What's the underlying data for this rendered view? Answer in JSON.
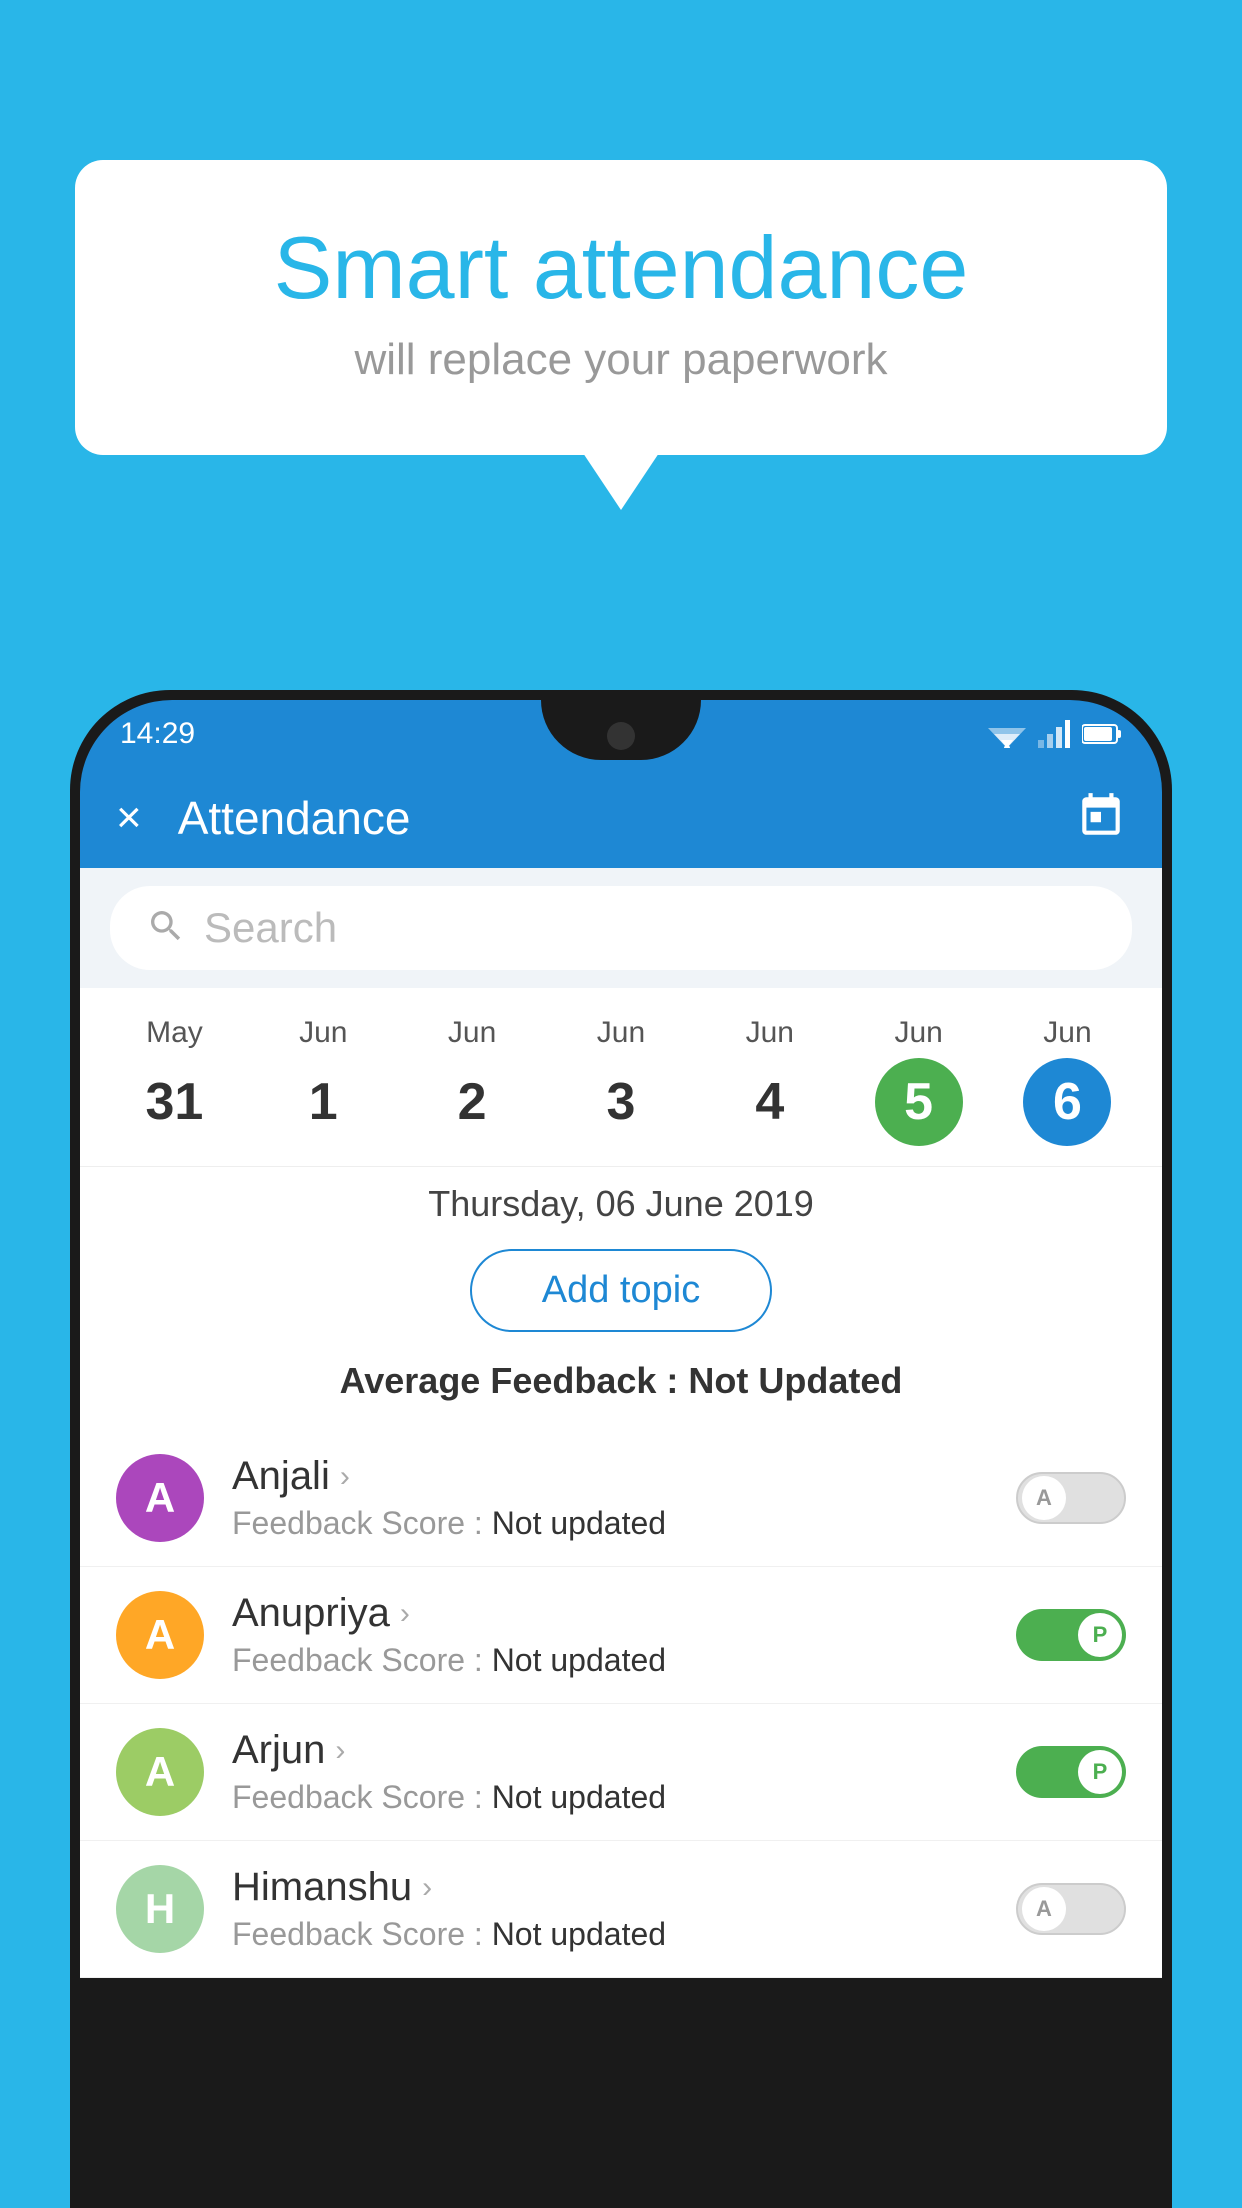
{
  "background_color": "#29b6e8",
  "bubble": {
    "title": "Smart attendance",
    "subtitle": "will replace your paperwork"
  },
  "status_bar": {
    "time": "14:29"
  },
  "app_bar": {
    "title": "Attendance",
    "close_label": "×"
  },
  "search": {
    "placeholder": "Search"
  },
  "calendar": {
    "days": [
      {
        "month": "May",
        "date": "31",
        "state": "normal"
      },
      {
        "month": "Jun",
        "date": "1",
        "state": "normal"
      },
      {
        "month": "Jun",
        "date": "2",
        "state": "normal"
      },
      {
        "month": "Jun",
        "date": "3",
        "state": "normal"
      },
      {
        "month": "Jun",
        "date": "4",
        "state": "normal"
      },
      {
        "month": "Jun",
        "date": "5",
        "state": "today"
      },
      {
        "month": "Jun",
        "date": "6",
        "state": "selected"
      }
    ],
    "selected_label": "Thursday, 06 June 2019"
  },
  "add_topic": {
    "label": "Add topic"
  },
  "avg_feedback": {
    "label": "Average Feedback :",
    "value": "Not Updated"
  },
  "students": [
    {
      "name": "Anjali",
      "avatar_letter": "A",
      "avatar_color": "#ab47bc",
      "feedback": "Feedback Score : Not updated",
      "toggle_state": "off",
      "toggle_label": "A"
    },
    {
      "name": "Anupriya",
      "avatar_letter": "A",
      "avatar_color": "#ffa726",
      "feedback": "Feedback Score : Not updated",
      "toggle_state": "on",
      "toggle_label": "P"
    },
    {
      "name": "Arjun",
      "avatar_letter": "A",
      "avatar_color": "#9ccc65",
      "feedback": "Feedback Score : Not updated",
      "toggle_state": "on",
      "toggle_label": "P"
    },
    {
      "name": "Himanshu",
      "avatar_letter": "H",
      "avatar_color": "#a5d6a7",
      "feedback": "Feedback Score : Not updated",
      "toggle_state": "off",
      "toggle_label": "A"
    }
  ]
}
